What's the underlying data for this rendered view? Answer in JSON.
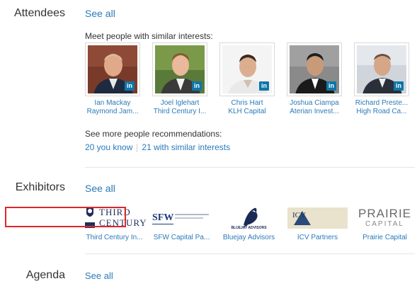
{
  "attendees": {
    "label": "Attendees",
    "see_all": "See all",
    "meet_text": "Meet people with similar interests:",
    "people": [
      {
        "name": "Ian Mackay",
        "company": "Raymond Jam..."
      },
      {
        "name": "Joel Iglehart",
        "company": "Third Century I..."
      },
      {
        "name": "Chris Hart",
        "company": "KLH Capital"
      },
      {
        "name": "Joshua Ciampa",
        "company": "Aterian Invest..."
      },
      {
        "name": "Richard Preste...",
        "company": "High Road Ca..."
      }
    ],
    "badge_text": "in",
    "more_text": "See more people recommendations:",
    "link_you_know": "20 you know",
    "link_similar": "21 with similar interests"
  },
  "exhibitors": {
    "label": "Exhibitors",
    "see_all": "See all",
    "items": [
      {
        "name": "Third Century In...",
        "logo_line1": "THIRD",
        "logo_line2": "CENTURY"
      },
      {
        "name": "SFW Capital Pa...",
        "logo_line1": "SFW"
      },
      {
        "name": "Bluejay Advisors",
        "logo_line1": "BLUEJAY ADVISORS"
      },
      {
        "name": "ICV Partners",
        "logo_line1": "ICV"
      },
      {
        "name": "Prairie Capital",
        "logo_line1": "PRAIRIE",
        "logo_line2": "CAPITAL"
      }
    ]
  },
  "agenda": {
    "label": "Agenda",
    "see_all": "See all"
  },
  "colors": {
    "link": "#2a7ab8",
    "linkedin": "#0e76a8",
    "highlight": "#e0262b"
  }
}
